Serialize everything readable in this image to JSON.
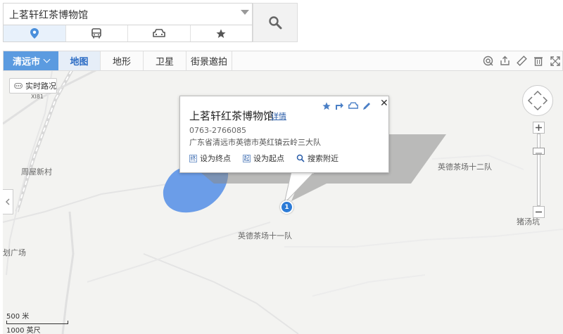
{
  "search": {
    "value": "上茗轩红茶博物馆",
    "placeholder": ""
  },
  "search_modes": [
    {
      "icon": "location-pin-icon"
    },
    {
      "icon": "bus-icon"
    },
    {
      "icon": "car-icon"
    },
    {
      "icon": "star-icon"
    }
  ],
  "toolbar": {
    "city": "清远市",
    "tabs": [
      "地图",
      "地形",
      "卫星",
      "街景邀拍"
    ],
    "active_tab": "地图",
    "tools": [
      "ranging-icon",
      "share-icon",
      "ruler-icon",
      "trash-icon",
      "fullscreen-icon"
    ]
  },
  "map": {
    "traffic_label": "实时路况",
    "labels": [
      "周屋新村",
      "英德茶场十二队",
      "英德茶场十一队",
      "猪汤坑",
      "划广场",
      "XI81"
    ],
    "marker_number": "1"
  },
  "info_window": {
    "title": "上茗轩红茶博物馆",
    "detail_link": "详情",
    "phone": "0763-2766085",
    "address": "广东省清远市英德市英红镇云岭三大队",
    "actions": [
      {
        "icon": "end-point-icon",
        "icon_text": "终",
        "label": "设为终点"
      },
      {
        "icon": "start-point-icon",
        "icon_text": "起",
        "label": "设为起点"
      },
      {
        "icon": "search-nearby-icon",
        "icon_text": "",
        "label": "搜索附近"
      }
    ]
  },
  "scale": {
    "metric": "500 米",
    "imperial": "1000 英尺"
  },
  "colors": {
    "accent": "#5b9be0",
    "water": "#6b9de8",
    "marker": "#2c7bd6",
    "link": "#2a5da8"
  }
}
